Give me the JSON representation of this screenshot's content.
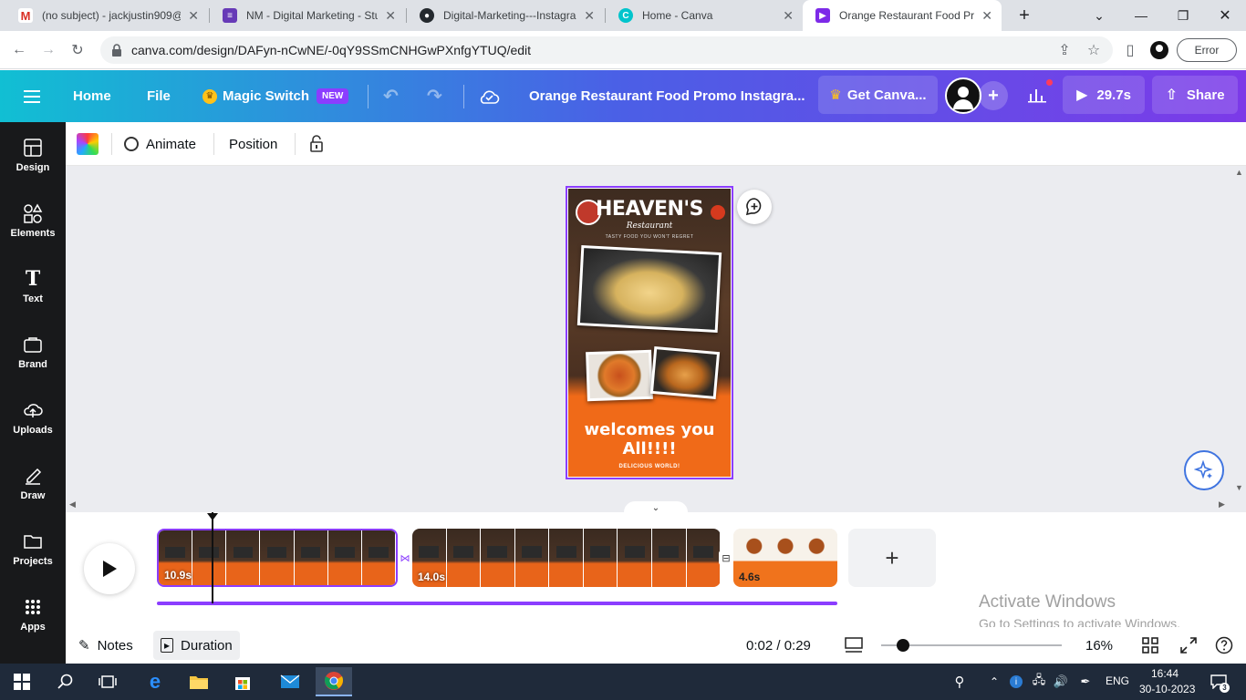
{
  "browser": {
    "tabs": [
      {
        "title": "(no subject) - jackjustin909@",
        "favicon": "gmail-icon",
        "color": "#d93025"
      },
      {
        "title": "NM - Digital Marketing - Stu",
        "favicon": "forms-icon",
        "color": "#673ab7"
      },
      {
        "title": "Digital-Marketing---Instagra",
        "favicon": "github-icon",
        "color": "#24292e"
      },
      {
        "title": "Home - Canva",
        "favicon": "canva-icon",
        "color": "#00c4cc"
      },
      {
        "title": "Orange Restaurant Food Pro",
        "favicon": "canva-video-icon",
        "color": "#7d2ae8"
      }
    ],
    "new_tab": "+",
    "url": "canva.com/design/DAFyn-nCwNE/-0qY9SSmCNHGwPXnfgYTUQ/edit",
    "error_label": "Error"
  },
  "header": {
    "home": "Home",
    "file": "File",
    "magic_switch": "Magic Switch",
    "new_badge": "NEW",
    "doc_title": "Orange Restaurant Food Promo Instagra...",
    "get_canva": "Get Canva...",
    "duration": "29.7s",
    "share": "Share"
  },
  "sidebar": {
    "items": [
      {
        "label": "Design",
        "icon": "design-icon"
      },
      {
        "label": "Elements",
        "icon": "elements-icon"
      },
      {
        "label": "Text",
        "icon": "text-icon"
      },
      {
        "label": "Brand",
        "icon": "brand-icon"
      },
      {
        "label": "Uploads",
        "icon": "uploads-icon"
      },
      {
        "label": "Draw",
        "icon": "draw-icon"
      },
      {
        "label": "Projects",
        "icon": "projects-icon"
      },
      {
        "label": "Apps",
        "icon": "apps-icon"
      }
    ]
  },
  "toolbar": {
    "animate": "Animate",
    "position": "Position"
  },
  "design": {
    "title": "HEAVEN'S",
    "subtitle": "Restaurant",
    "tagline": "TASTY FOOD YOU WON'T REGRET",
    "welcome_line1": "welcomes you",
    "welcome_line2": "All!!!!",
    "bottom": "DELICIOUS WORLD!"
  },
  "timeline": {
    "clips": [
      {
        "duration": "10.9s"
      },
      {
        "duration": "14.0s"
      },
      {
        "duration": "4.6s"
      }
    ],
    "add": "+"
  },
  "footer": {
    "notes": "Notes",
    "duration": "Duration",
    "time": "0:02 / 0:29",
    "zoom": "16%"
  },
  "watermark": {
    "line1": "Activate Windows",
    "line2": "Go to Settings to activate Windows."
  },
  "taskbar": {
    "lang": "ENG",
    "time": "16:44",
    "date": "30-10-2023",
    "notifications": "3"
  }
}
